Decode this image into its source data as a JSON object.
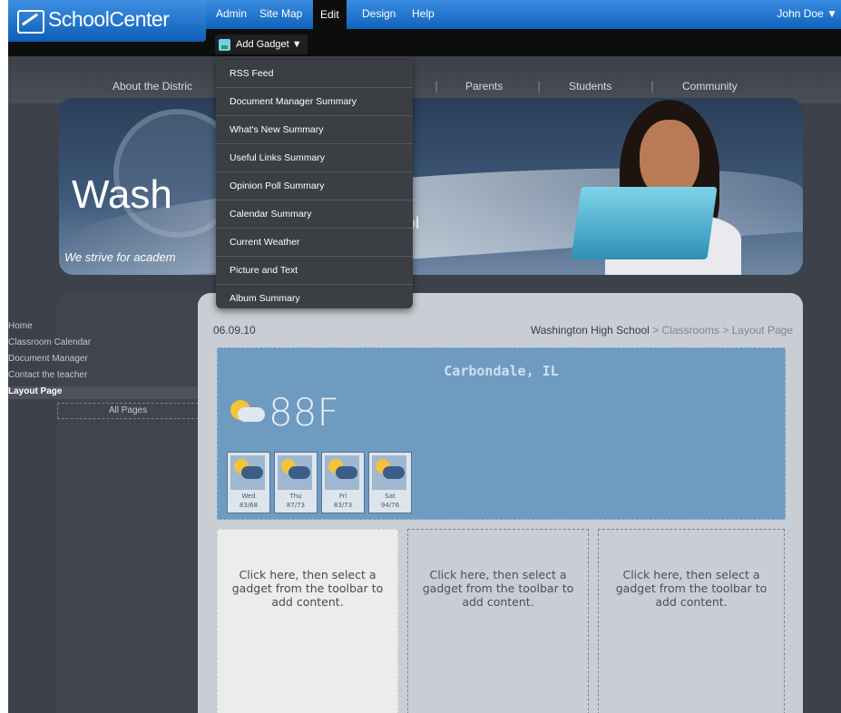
{
  "app": {
    "logo_text": "SchoolCenter",
    "menu": [
      "Admin",
      "Site Map",
      "Edit",
      "Design",
      "Help"
    ],
    "active_menu": "Edit",
    "user": "John Doe ▼",
    "add_gadget_label": "Add Gadget ▼"
  },
  "dropdown": {
    "items": [
      "RSS Feed",
      "Document Manager Summary",
      "What's New Summary",
      "Useful Links Summary",
      "Opinion Poll Summary",
      "Calendar Summary",
      "Current Weather",
      "Picture and Text",
      "Album Summary"
    ]
  },
  "site_nav": {
    "items": [
      "About the Distric",
      "Parents",
      "Students",
      "Community"
    ]
  },
  "banner": {
    "title": "Wash",
    "tagline": "We strive for academ",
    "title_tail": "ol"
  },
  "sidebar": {
    "items": [
      "Home",
      "Classroom Calendar",
      "Document Manager",
      "Contact the teacher",
      "Layout Page"
    ],
    "active": "Layout Page",
    "all_pages": "All Pages"
  },
  "page": {
    "date": "06.09.10",
    "breadcrumb": {
      "school": "Washington High School",
      "sep": ">",
      "classrooms": "Classrooms",
      "current": "Layout Page"
    }
  },
  "weather": {
    "city": "Carbondale, IL",
    "temperature": "88F",
    "forecast": [
      {
        "day": "Wed",
        "range": "83/68"
      },
      {
        "day": "Thu",
        "range": "87/73"
      },
      {
        "day": "Fri",
        "range": "83/73"
      },
      {
        "day": "Sat",
        "range": "94/76"
      }
    ]
  },
  "columns": {
    "left": "Click here, then select a gadget from the toolbar to add content.",
    "middle": "Click here, then select a gadget from the toolbar to add content.",
    "right": "Click here, then select a gadget from the toolbar to add content."
  }
}
